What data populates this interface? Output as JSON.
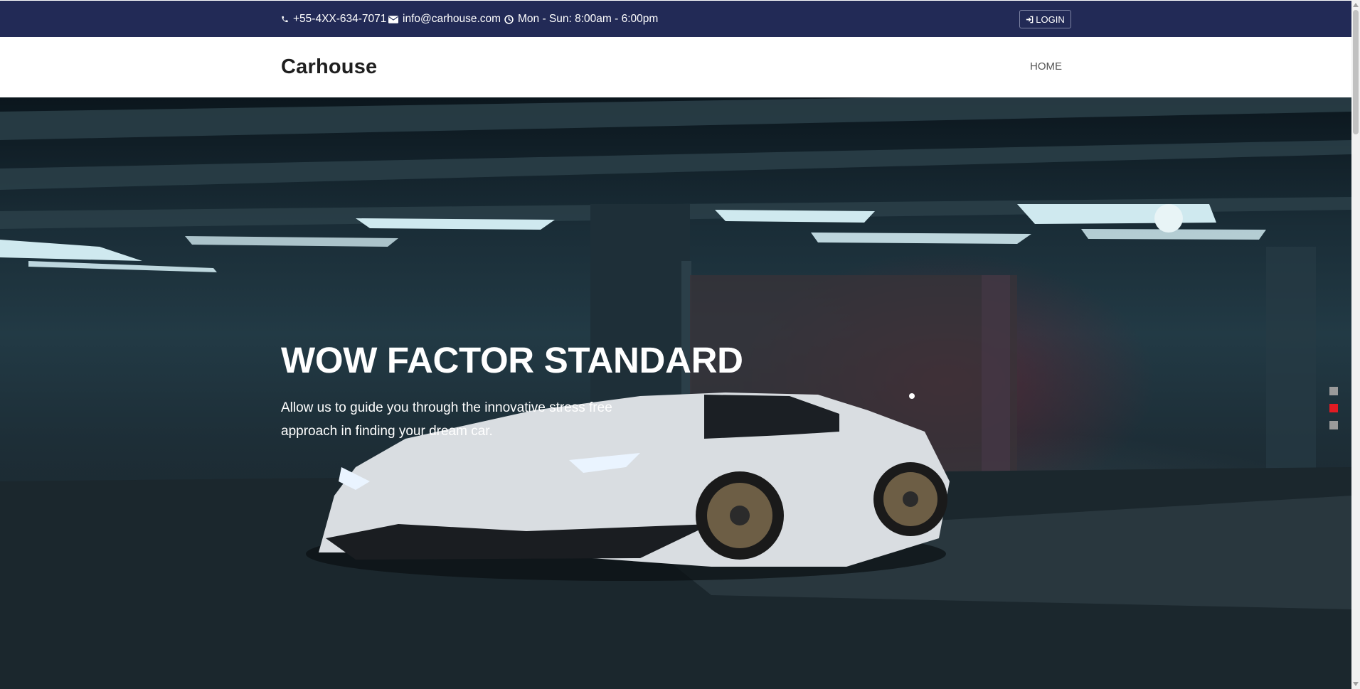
{
  "topbar": {
    "phone": "+55-4XX-634-7071",
    "email": "info@carhouse.com",
    "hours": "Mon - Sun: 8:00am - 6:00pm",
    "login_label": "LOGIN",
    "icons": [
      "phone-icon",
      "envelope-icon",
      "clock-icon",
      "sign-in-icon"
    ],
    "background_color": "#222a56"
  },
  "navbar": {
    "brand": "Carhouse",
    "items": [
      {
        "label": "HOME"
      }
    ]
  },
  "hero": {
    "title": "WOW FACTOR STANDARD",
    "subtitle": "Allow us to guide you through the innovative stress free approach in finding your dream car.",
    "slider": {
      "slide_count": 3,
      "active_index": 1,
      "active_color": "#e21b23",
      "inactive_color": "#9a9a9a"
    }
  }
}
